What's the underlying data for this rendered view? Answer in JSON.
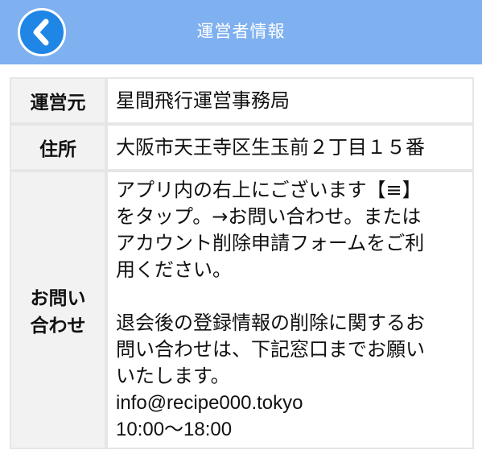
{
  "header": {
    "title": "運営者情報",
    "back_icon": "chevron-left-icon"
  },
  "rows": [
    {
      "label": "運営元",
      "value": "星間飛行運営事務局"
    },
    {
      "label": "住所",
      "value": "大阪市天王寺区生玉前２丁目１５番"
    }
  ],
  "contact": {
    "label_line1": "お問い",
    "label_line2": "合わせ",
    "para1": [
      "アプリ内の右上にございます【≡】",
      "をタップ。→お問い合わせ。または",
      "アカウント削除申請フォームをご利",
      "用ください。"
    ],
    "para2": [
      "退会後の登録情報の削除に関するお",
      "問い合わせは、下記窓口までお願い",
      "いたします。"
    ],
    "email": "info@recipe000.tokyo",
    "hours": "10:00〜18:00"
  },
  "colors": {
    "header_bg": "#7fb0f0",
    "back_button": "#1f86e6",
    "label_bg": "#f2f2f2",
    "border": "#e6e6e6"
  }
}
